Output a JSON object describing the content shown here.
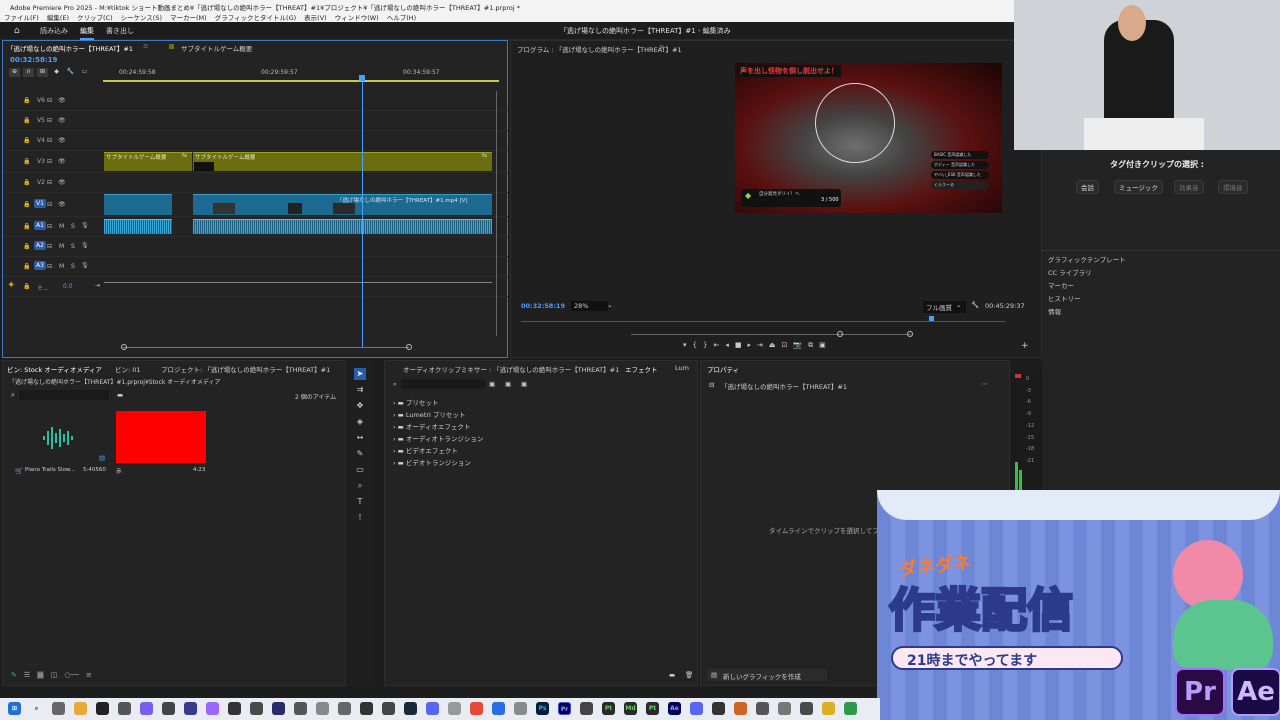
{
  "window": {
    "title": "Adobe Premiere Pro 2025 - M:¥tiktok ショート動画まとめ¥「逃げ場なしの絶叫ホラー【THREAT】#1¥プロジェクト¥「逃げ場なしの絶叫ホラー【THREAT】#1.prproj *",
    "menu": [
      "ファイル(F)",
      "編集(E)",
      "クリップ(C)",
      "シーケンス(S)",
      "マーカー(M)",
      "グラフィックとタイトル(G)",
      "表示(V)",
      "ウィンドウ(W)",
      "ヘルプ(H)"
    ]
  },
  "workspace": {
    "tabs": [
      "読み込み",
      "編集",
      "書き出し"
    ],
    "active": "編集",
    "center_title": "「逃げ場なしの絶叫ホラー【THREAT】#1 - 編集済み"
  },
  "timeline": {
    "tabs": [
      "「逃げ場なしの絶叫ホラー【THREAT】#1",
      "サブタイトルゲーム概要"
    ],
    "timecode": "00:32:58:19",
    "ruler": [
      "00:24:59:58",
      "00:29:59:57",
      "00:34:59:57"
    ],
    "tracks": [
      {
        "name": "V6"
      },
      {
        "name": "V5"
      },
      {
        "name": "V4"
      },
      {
        "name": "V3"
      },
      {
        "name": "V2"
      },
      {
        "name": "V1"
      },
      {
        "name": "A1"
      },
      {
        "name": "A2"
      },
      {
        "name": "A3"
      }
    ],
    "master": {
      "label": "ミ...",
      "value": "0.0"
    },
    "clips": {
      "subtitle1": "サブタイトルゲーム概要",
      "subtitle2": "サブタイトルゲーム概要",
      "fx": "fx",
      "video_main": "「逃げ場なしの絶叫ホラー【THREAT】#1.mp4 [V]"
    }
  },
  "program": {
    "title": "プログラム : 「逃げ場なしの絶叫ホラー【THREAT】#1",
    "timecode": "00:32:58:19",
    "zoom": "28%",
    "quality": "フル画質",
    "duration": "00:45:29:37",
    "game_overlay": {
      "headline": "声を出し怪物を倒し脱出せよ！",
      "progress_label": "自分発見ダリイ！へ",
      "progress_value": "3 / 500",
      "chat": [
        "BASIC 音声認識した",
        "ボディー 音声認識した",
        "ヤバい_ESK 音声認識した",
        "くらうーる"
      ]
    }
  },
  "tagged_clips": {
    "title": "タグ付きクリップの選択 :",
    "chips": [
      {
        "label": "会話",
        "active": true
      },
      {
        "label": "ミュージック",
        "active": true
      },
      {
        "label": "効果音",
        "active": false
      },
      {
        "label": "環境音",
        "active": false
      }
    ],
    "list": [
      "グラフィックテンプレート",
      "CC ライブラリ",
      "マーカー",
      "ヒストリー",
      "情報"
    ]
  },
  "bin": {
    "tabs": [
      "ビン: Stock オーディオメディア",
      "ビン: 01",
      "プロジェクト: 「逃げ場なしの絶叫ホラー【THREAT】#1",
      "オーディオクリップミキサー : 「逃げ場なしの絶叫ホラー【THREAT】#1"
    ],
    "path": "「逃げ場なしの絶叫ホラー【THREAT】#1.prproj¥Stock オーディオメディア",
    "item_count": "2 個のアイテム",
    "items": [
      {
        "name": "Piano Trails Slow...",
        "duration": "5:40560"
      },
      {
        "name": "赤",
        "duration": "4:23",
        "color": "#ff0000"
      }
    ]
  },
  "effects": {
    "tabs": [
      "エフェクト",
      "Lum"
    ],
    "items": [
      "プリセット",
      "Lumetri プリセット",
      "オーディオエフェクト",
      "オーディオトランジション",
      "ビデオエフェクト",
      "ビデオトランジション"
    ]
  },
  "properties": {
    "tab": "プロパティ",
    "sequence": "「逃げ場なしの絶叫ホラー【THREAT】#1",
    "hint": "タイムラインでクリップを選択してプロ",
    "new_graphic": "新しいグラフィックを作成"
  },
  "meter": {
    "scale": [
      "0",
      "-3",
      "-6",
      "-9",
      "-12",
      "-15",
      "-18",
      "-21"
    ]
  },
  "banner": {
    "small_title": "ダネダネ",
    "main_title": "作業配信",
    "subtitle": "21時までやってます",
    "apps": [
      "Pr",
      "Ae"
    ]
  },
  "colors": {
    "accent": "#4aa0ff",
    "video_track": "#1d6a91",
    "graphic_track": "#6a6e10",
    "banner": "#6f87d8"
  }
}
